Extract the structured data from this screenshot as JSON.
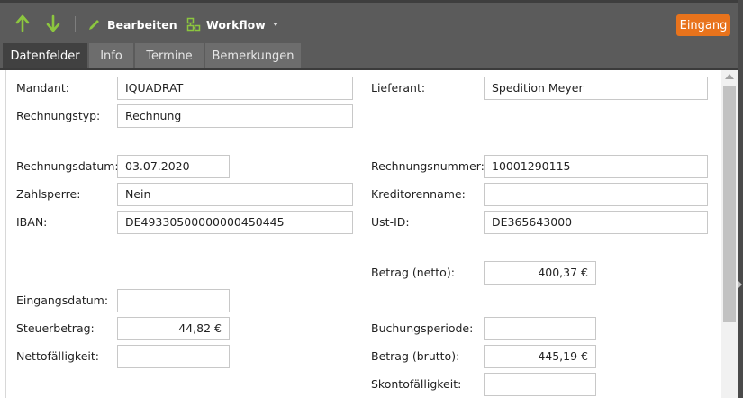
{
  "toolbar": {
    "edit_label": "Bearbeiten",
    "workflow_label": "Workflow",
    "status_badge": "Eingang",
    "accent_green": "#8cc63f",
    "badge_color": "#e8731c"
  },
  "tabs": [
    {
      "label": "Datenfelder",
      "active": true
    },
    {
      "label": "Info",
      "active": false
    },
    {
      "label": "Termine",
      "active": false
    },
    {
      "label": "Bemerkungen",
      "active": false
    }
  ],
  "fields": {
    "mandant": {
      "label": "Mandant:",
      "value": "IQUADRAT"
    },
    "lieferant": {
      "label": "Lieferant:",
      "value": "Spedition Meyer"
    },
    "rechnungstyp": {
      "label": "Rechnungstyp:",
      "value": "Rechnung"
    },
    "rechnungsdatum": {
      "label": "Rechnungsdatum:",
      "value": "03.07.2020"
    },
    "rechnungsnummer": {
      "label": "Rechnungsnummer:",
      "value": "10001290115"
    },
    "zahlsperre": {
      "label": "Zahlsperre:",
      "value": "Nein"
    },
    "kreditorenname": {
      "label": "Kreditorenname:",
      "value": ""
    },
    "iban": {
      "label": "IBAN:",
      "value": "DE49330500000000450445"
    },
    "ustid": {
      "label": "Ust-ID:",
      "value": "DE365643000"
    },
    "betrag_netto": {
      "label": "Betrag (netto):",
      "value": "400,37 €"
    },
    "eingangsdatum": {
      "label": "Eingangsdatum:",
      "value": ""
    },
    "steuerbetrag": {
      "label": "Steuerbetrag:",
      "value": "44,82 €"
    },
    "buchungsperiode": {
      "label": "Buchungsperiode:",
      "value": ""
    },
    "nettofaelligkeit": {
      "label": "Nettofälligkeit:",
      "value": ""
    },
    "betrag_brutto": {
      "label": "Betrag (brutto):",
      "value": "445,19 €"
    },
    "skontofaelligkeit": {
      "label": "Skontofälligkeit:",
      "value": ""
    }
  }
}
